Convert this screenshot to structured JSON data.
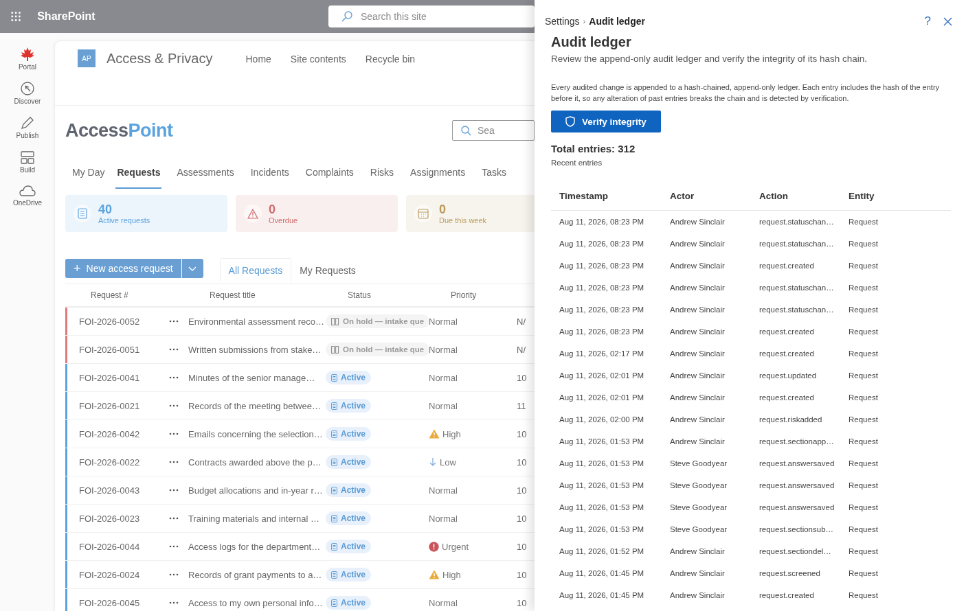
{
  "suite_bar": {
    "app_name": "SharePoint",
    "search": {
      "placeholder": "Search this site"
    }
  },
  "app_rail": [
    {
      "label": "Portal",
      "kind": "leaf"
    },
    {
      "label": "Discover",
      "kind": "compass"
    },
    {
      "label": "Publish",
      "kind": "pen"
    },
    {
      "label": "Build",
      "kind": "grid"
    },
    {
      "label": "OneDrive",
      "kind": "cloud"
    }
  ],
  "site": {
    "logo": "AP",
    "title": "Access & Privacy",
    "nav": [
      "Home",
      "Site contents",
      "Recycle bin"
    ]
  },
  "app": {
    "brand_first": "Access",
    "brand_second": "Point",
    "search": {
      "placeholder": "Sea"
    },
    "tabs": [
      {
        "label": "My Day",
        "selected": false
      },
      {
        "label": "Requests",
        "selected": true
      },
      {
        "label": "Assessments",
        "selected": false
      },
      {
        "label": "Incidents",
        "selected": false
      },
      {
        "label": "Complaints",
        "selected": false
      },
      {
        "label": "Risks",
        "selected": false
      },
      {
        "label": "Assignments",
        "selected": false
      },
      {
        "label": "Tasks",
        "selected": false
      }
    ],
    "stats": [
      {
        "value": "40",
        "label": "Active requests",
        "color": "#5ba3e0",
        "kind": "list"
      },
      {
        "value": "0",
        "label": "Overdue",
        "color": "#cf6b6b",
        "kind": "warning"
      },
      {
        "value": "0",
        "label": "Due this week",
        "color": "#b99a5c",
        "kind": "calendar"
      }
    ],
    "new_button": {
      "label": "New access request",
      "icon": "+"
    },
    "views": [
      {
        "label": "All Requests",
        "selected": true
      },
      {
        "label": "My Requests",
        "selected": false
      }
    ],
    "table": {
      "columns": [
        "Request #",
        "Request title",
        "Status",
        "Priority"
      ],
      "rows": [
        {
          "number": "FOI-2026-0052",
          "title": "Environmental assessment reco…",
          "status": {
            "text": "On hold — intake que",
            "kind": "on_hold"
          },
          "priority": {
            "text": "Normal",
            "kind": "normal"
          },
          "column_5": "N/",
          "color": "#e07a7a"
        },
        {
          "number": "FOI-2026-0051",
          "title": "Written submissions from stake…",
          "status": {
            "text": "On hold — intake que",
            "kind": "on_hold"
          },
          "priority": {
            "text": "Normal",
            "kind": "normal"
          },
          "column_5": "N/",
          "color": "#e07a7a"
        },
        {
          "number": "FOI-2026-0041",
          "title": "Minutes of the senior manage…",
          "status": {
            "text": "Active",
            "kind": "active"
          },
          "priority": {
            "text": "Normal",
            "kind": "normal"
          },
          "column_5": "10",
          "color": "#5ba3e0"
        },
        {
          "number": "FOI-2026-0021",
          "title": "Records of the meeting betwee…",
          "status": {
            "text": "Active",
            "kind": "active"
          },
          "priority": {
            "text": "Normal",
            "kind": "normal"
          },
          "column_5": "11",
          "color": "#5ba3e0"
        },
        {
          "number": "FOI-2026-0042",
          "title": "Emails concerning the selection…",
          "status": {
            "text": "Active",
            "kind": "active"
          },
          "priority": {
            "text": "High",
            "kind": "high"
          },
          "column_5": "10",
          "color": "#5ba3e0"
        },
        {
          "number": "FOI-2026-0022",
          "title": "Contracts awarded above the p…",
          "status": {
            "text": "Active",
            "kind": "active"
          },
          "priority": {
            "text": "Low",
            "kind": "low"
          },
          "column_5": "10",
          "color": "#5ba3e0"
        },
        {
          "number": "FOI-2026-0043",
          "title": "Budget allocations and in-year r…",
          "status": {
            "text": "Active",
            "kind": "active"
          },
          "priority": {
            "text": "Normal",
            "kind": "normal"
          },
          "column_5": "10",
          "color": "#5ba3e0"
        },
        {
          "number": "FOI-2026-0023",
          "title": "Training materials and internal …",
          "status": {
            "text": "Active",
            "kind": "active"
          },
          "priority": {
            "text": "Normal",
            "kind": "normal"
          },
          "column_5": "10",
          "color": "#5ba3e0"
        },
        {
          "number": "FOI-2026-0044",
          "title": "Access logs for the department…",
          "status": {
            "text": "Active",
            "kind": "active"
          },
          "priority": {
            "text": "Urgent",
            "kind": "urgent"
          },
          "column_5": "10",
          "color": "#5ba3e0"
        },
        {
          "number": "FOI-2026-0024",
          "title": "Records of grant payments to a…",
          "status": {
            "text": "Active",
            "kind": "active"
          },
          "priority": {
            "text": "High",
            "kind": "high"
          },
          "column_5": "10",
          "color": "#5ba3e0"
        },
        {
          "number": "FOI-2026-0045",
          "title": "Access to my own personal info…",
          "status": {
            "text": "Active",
            "kind": "active"
          },
          "priority": {
            "text": "Normal",
            "kind": "normal"
          },
          "column_5": "10",
          "color": "#5ba3e0"
        }
      ]
    }
  },
  "panel": {
    "breadcrumb": [
      "Settings",
      "Audit ledger"
    ],
    "separator": "›",
    "help": "?",
    "title": "Audit ledger",
    "subtitle": "Review the append-only audit ledger and verify the integrity of its hash chain.",
    "description": "Every audited change is appended to a hash-chained, append-only ledger. Each entry includes the hash of the entry before it, so any alteration of past entries breaks the chain and is detected by verification.",
    "verify_button": "Verify integrity",
    "total": "Total entries: 312",
    "recent_label": "Recent entries",
    "table": {
      "columns": [
        "Timestamp",
        "Actor",
        "Action",
        "Entity"
      ],
      "rows": [
        [
          "Aug 11, 2026, 08:23 PM",
          "Andrew Sinclair",
          "request.statuschan…",
          "Request"
        ],
        [
          "Aug 11, 2026, 08:23 PM",
          "Andrew Sinclair",
          "request.statuschan…",
          "Request"
        ],
        [
          "Aug 11, 2026, 08:23 PM",
          "Andrew Sinclair",
          "request.created",
          "Request"
        ],
        [
          "Aug 11, 2026, 08:23 PM",
          "Andrew Sinclair",
          "request.statuschan…",
          "Request"
        ],
        [
          "Aug 11, 2026, 08:23 PM",
          "Andrew Sinclair",
          "request.statuschan…",
          "Request"
        ],
        [
          "Aug 11, 2026, 08:23 PM",
          "Andrew Sinclair",
          "request.created",
          "Request"
        ],
        [
          "Aug 11, 2026, 02:17 PM",
          "Andrew Sinclair",
          "request.created",
          "Request"
        ],
        [
          "Aug 11, 2026, 02:01 PM",
          "Andrew Sinclair",
          "request.updated",
          "Request"
        ],
        [
          "Aug 11, 2026, 02:01 PM",
          "Andrew Sinclair",
          "request.created",
          "Request"
        ],
        [
          "Aug 11, 2026, 02:00 PM",
          "Andrew Sinclair",
          "request.riskadded",
          "Request"
        ],
        [
          "Aug 11, 2026, 01:53 PM",
          "Andrew Sinclair",
          "request.sectionapp…",
          "Request"
        ],
        [
          "Aug 11, 2026, 01:53 PM",
          "Steve Goodyear",
          "request.answersaved",
          "Request"
        ],
        [
          "Aug 11, 2026, 01:53 PM",
          "Steve Goodyear",
          "request.answersaved",
          "Request"
        ],
        [
          "Aug 11, 2026, 01:53 PM",
          "Steve Goodyear",
          "request.answersaved",
          "Request"
        ],
        [
          "Aug 11, 2026, 01:53 PM",
          "Steve Goodyear",
          "request.sectionsub…",
          "Request"
        ],
        [
          "Aug 11, 2026, 01:52 PM",
          "Andrew Sinclair",
          "request.sectiondel…",
          "Request"
        ],
        [
          "Aug 11, 2026, 01:45 PM",
          "Andrew Sinclair",
          "request.screened",
          "Request"
        ],
        [
          "Aug 11, 2026, 01:45 PM",
          "Andrew Sinclair",
          "request.created",
          "Request"
        ]
      ]
    }
  }
}
